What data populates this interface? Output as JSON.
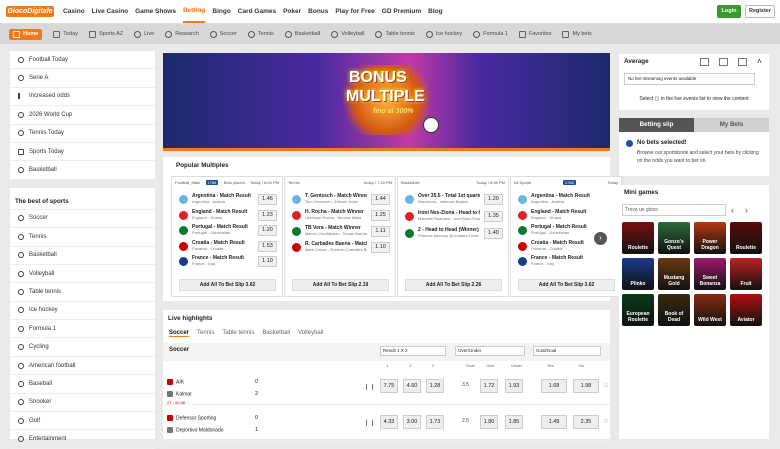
{
  "brand": {
    "logo_text": "GiocoDigitale",
    "accent": "#f07a1a"
  },
  "nav": {
    "items": [
      "Casino",
      "Live Casino",
      "Game Shows",
      "Betting",
      "Bingo",
      "Card Games",
      "Poker",
      "Bonus",
      "Play for Free",
      "GD Premium",
      "Blog"
    ],
    "active": "Betting",
    "login": "Login",
    "register": "Register"
  },
  "subnav": {
    "items": [
      "Home",
      "Today",
      "Sports AZ",
      "Live",
      "Research",
      "Soccer",
      "Tennis",
      "Basketball",
      "Volleyball",
      "Table tennis",
      "Ice hockey",
      "Formula 1",
      "Favorites",
      "My bets"
    ]
  },
  "left": {
    "top_items": [
      "Football Today",
      "Serie A",
      "Increased odds",
      "2026 World Cup",
      "Tennis Today",
      "Sports Today",
      "Basketball"
    ],
    "best_title": "The best of sports",
    "best_items": [
      "Soccer",
      "Tennis",
      "Basketball",
      "Volleyball",
      "Table tennis",
      "Ice hockey",
      "Formula 1",
      "Cycling",
      "American football",
      "Baseball",
      "Snooker",
      "Golf",
      "Entertainment"
    ]
  },
  "banner": {
    "line1": "BONUS",
    "line2": "MULTIPLE",
    "line3": "fino al 300%"
  },
  "popular": {
    "title": "Popular Multiples",
    "cards": [
      {
        "sport": "Football_Main",
        "badge": "1766",
        "placed": "Bets placed",
        "date": "Today / 8:00 PM",
        "btn": "Add All To Bet Slip 3.62",
        "rows": [
          {
            "t1": "Argentina - Match Result",
            "t2": "Argentina - Austria",
            "odd": "1.46"
          },
          {
            "t1": "England - Match Result",
            "t2": "England - Ghana",
            "odd": "1.23"
          },
          {
            "t1": "Portugal - Match Result",
            "t2": "Portugal - Uzbekistan",
            "odd": "1.20"
          },
          {
            "t1": "Croatia - Match Result",
            "t2": "Panama - Croatia",
            "odd": "1.53"
          },
          {
            "t1": "France - Match Result",
            "t2": "France - Iraq",
            "odd": "1.10"
          }
        ]
      },
      {
        "sport": "Tennis",
        "badge": "",
        "placed": "",
        "date": "Today / 7:15 PM",
        "btn": "Add All To Bet Slip 2.19",
        "rows": [
          {
            "t1": "T. Gentzsch - Match Winner",
            "t2": "Tom Gentzsch - Zdenek Kolar",
            "odd": "1.44"
          },
          {
            "t1": "H. Rocha - Match Winner",
            "t2": "Henrique Rocha - Nicolas Mejia",
            "odd": "1.25"
          },
          {
            "t1": "TB Vera - Match Winner",
            "t2": "Marcio Cinzibtlaldo - Tomas Barrios Vera",
            "odd": "1.11"
          },
          {
            "t1": "R. Carballes Baena - Match Winner",
            "t2": "Mark Cehan - Roberto Carballes Baena",
            "odd": "1.10"
          }
        ]
      },
      {
        "sport": "Basketball",
        "badge": "",
        "placed": "",
        "date": "Today / 8:55 PM",
        "btn": "Add All To Bet Slip 2.26",
        "rows": [
          {
            "t1": "Over 35.5 - Total 1st quarter",
            "t2": "Barcelona - Valencia Basket",
            "odd": "1.20"
          },
          {
            "t1": "Ironi Nes-Ziona - Head to Head (Winner)",
            "t2": "Maccabi Raanana - Ironi Nes-Ziona",
            "odd": "1.35"
          },
          {
            "t1": "2 - Head to Head (Winner)",
            "t2": "Phoenix Mercury @ Indiana Fever",
            "odd": "1.40"
          }
        ]
      },
      {
        "sport": "All Sports",
        "badge": "1766",
        "placed": "",
        "date": "Today",
        "btn": "Add All To Bet Slip 3.62",
        "rows": [
          {
            "t1": "Argentina - Match Result",
            "t2": "Argentina - Austria",
            "odd": ""
          },
          {
            "t1": "England - Match Result",
            "t2": "England - Ghana",
            "odd": ""
          },
          {
            "t1": "Portugal - Match Result",
            "t2": "Portugal - Uzbekistan",
            "odd": ""
          },
          {
            "t1": "Croatia - Match Result",
            "t2": "Panama - Croatia",
            "odd": ""
          },
          {
            "t1": "France - Match Result",
            "t2": "France - Iraq",
            "odd": ""
          }
        ]
      }
    ]
  },
  "live": {
    "title": "Live highlights",
    "tabs": [
      "Soccer",
      "Tennis",
      "Table tennis",
      "Basketball",
      "Volleyball"
    ],
    "sport_label": "Soccer",
    "sel1": "Result 1 X 2",
    "sel2": "Over/Under",
    "sel3": "Goal/Goal",
    "cols": [
      "1",
      "X",
      "2",
      "Goal",
      "Over",
      "Under",
      "Yes",
      "No"
    ],
    "matches": [
      {
        "home": "AIK",
        "away": "Kalmar",
        "hs": "0",
        "as": "2",
        "time": "2T - 50:46",
        "o1": "7.75",
        "ox": "4.60",
        "o2": "1.28",
        "goal": "3.5",
        "over": "1.72",
        "under": "1.93",
        "yes": "1.68",
        "no": "1.98"
      },
      {
        "home": "Defensor Sporting",
        "away": "Deportivo Maldonado",
        "hs": "0",
        "as": "1",
        "time": "",
        "o1": "4.33",
        "ox": "3.00",
        "o2": "1.73",
        "goal": "2.5",
        "over": "1.80",
        "under": "1.85",
        "yes": "1.49",
        "no": "2.35"
      }
    ]
  },
  "average": {
    "title": "Average",
    "select": "No live streaming events available",
    "msg": "Select ▢ in the live events list to view the content"
  },
  "betslip": {
    "tab1": "Betting slip",
    "tab2": "My Bets",
    "heading": "No bets selected!",
    "text": "Browse our sportsbook and select your bets by clicking on the odds you want to bet on."
  },
  "mini": {
    "title": "Mini games",
    "search_placeholder": "Trova un gioco",
    "games": [
      {
        "name": "Roulette",
        "color": "#7a1010"
      },
      {
        "name": "Gonzo's Quest",
        "color": "#2a6a3a"
      },
      {
        "name": "Power Dragon",
        "color": "#b33a10"
      },
      {
        "name": "Roulette",
        "color": "#5a0a0a"
      },
      {
        "name": "Plinko",
        "color": "#1a3a8a"
      },
      {
        "name": "Mustang Gold",
        "color": "#6a3a10"
      },
      {
        "name": "Sweet Bonanza",
        "color": "#a01a6a"
      },
      {
        "name": "Fruit",
        "color": "#c02020"
      },
      {
        "name": "European Roulette",
        "color": "#0a3a1a"
      },
      {
        "name": "Book of Dead",
        "color": "#3a2a10"
      },
      {
        "name": "Wild West",
        "color": "#8a2a10"
      },
      {
        "name": "Aviator",
        "color": "#b01010"
      }
    ]
  }
}
